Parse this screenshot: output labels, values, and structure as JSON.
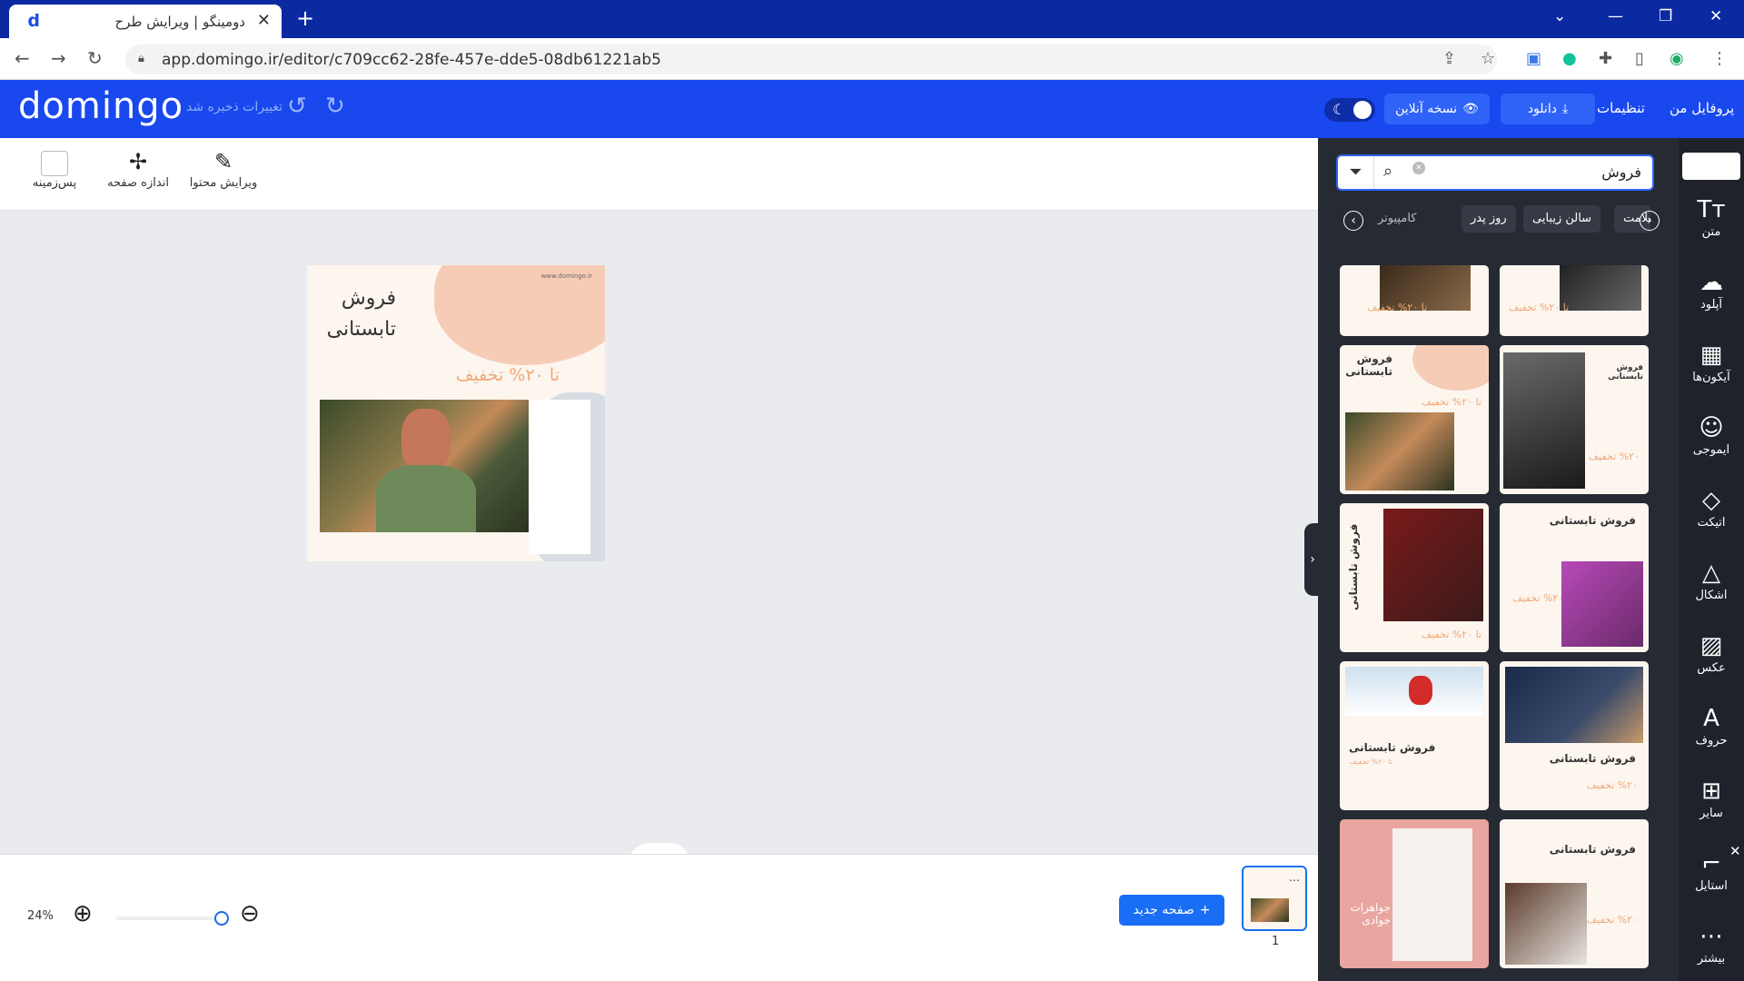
{
  "browser": {
    "tab_title": "دومینگو | ویرایش طرح",
    "tab_close": "✕",
    "new_tab": "+",
    "url": "app.domingo.ir/editor/c709cc62-28fe-457e-dde5-08db61221ab5"
  },
  "app": {
    "logo": "domingo",
    "saved_text": "تغییرات ذخیره شد",
    "profile": "پروفایل من",
    "settings": "تنظیمات",
    "download": "دانلود",
    "online_version": "نسخه آنلاین"
  },
  "toolbar": {
    "background": "پس‌زمینه",
    "page_size": "اندازه صفحه",
    "edit_content": "ویرایش محتوا"
  },
  "design": {
    "site": "www.domingo.ir",
    "title": "فروش تابستانی",
    "discount": "تا ۲۰% تخفیف"
  },
  "bottom": {
    "zoom": "24%",
    "new_page": "صفحه جدید",
    "page_number": "1"
  },
  "panel": {
    "search_value": "فروش",
    "categories": [
      "سلامت",
      "سالن زیبایی",
      "روز پدر",
      "کامپیوتر"
    ],
    "templates": [
      {
        "title": "",
        "discount": "تا ۲۰% تخفیف"
      },
      {
        "title": "",
        "discount": "تا ۲۰% تخفیف"
      },
      {
        "title": "فروش تابستانی",
        "discount": "تا ۲۰% تخفیف"
      },
      {
        "title": "فروش تابستانی",
        "discount": "%۲۰ تخفیف"
      },
      {
        "title": "فروش تابستانی",
        "discount": "تا ۲۰% تخفیف"
      },
      {
        "title": "فروش تابستانی",
        "discount": "%۲۰ تخفیف"
      },
      {
        "title": "فروش تابستانی",
        "discount": "تا ۲۰% تخفیف"
      },
      {
        "title": "فروش تابستانی",
        "discount": "%۲۰ تخفیف"
      },
      {
        "title": "جواهرات جوادی",
        "discount": ""
      },
      {
        "title": "فروش تابستانی",
        "discount": "%۲۰ تخفیف"
      }
    ]
  },
  "rail": {
    "text": "متن",
    "upload": "آپلود",
    "icons": "آیکون‌ها",
    "emoji": "ایموجی",
    "sticker": "اتیکت",
    "shapes": "اشکال",
    "photo": "عکس",
    "letters": "حروف",
    "other": "سایر",
    "style": "استایل",
    "more": "بیشتر"
  },
  "colors": {
    "brand": "#1848ee",
    "panel": "#262a33",
    "accent": "#f0a878"
  }
}
